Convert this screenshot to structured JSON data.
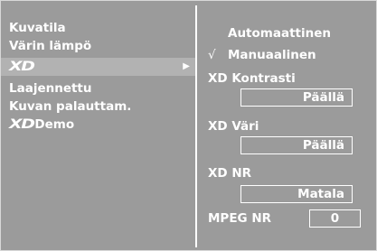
{
  "left_menu": {
    "items": [
      {
        "label": "Kuvatila"
      },
      {
        "label": "Värin lämpö"
      },
      {
        "logo_text": "XD",
        "arrow": "▶"
      },
      {
        "label": "Laajennettu"
      },
      {
        "label": "Kuvan palauttam."
      },
      {
        "logo_text": "XD",
        "label": "Demo"
      }
    ]
  },
  "right_panel": {
    "mode_auto": "Automaattinen",
    "mode_manual": "Manuaalinen",
    "check_mark": "√",
    "xd_contrast_label": "XD Kontrasti",
    "xd_contrast_value": "Päällä",
    "xd_color_label": "XD Väri",
    "xd_color_value": "Päällä",
    "xd_nr_label": "XD NR",
    "xd_nr_value": "Matala",
    "mpeg_nr_label": "MPEG NR",
    "mpeg_nr_value": "0"
  },
  "colors": {
    "panel_bg": "#9b9b9b",
    "highlight_bg": "#b2b2b2",
    "text": "#ffffff"
  }
}
